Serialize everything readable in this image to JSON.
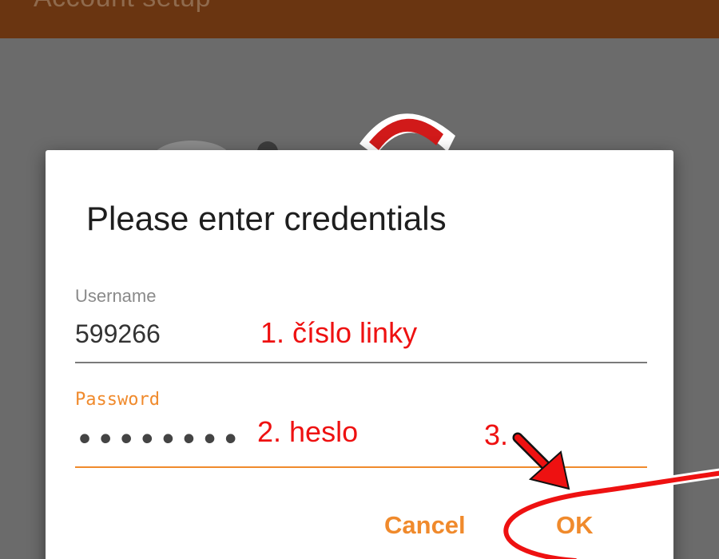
{
  "app_bar": {
    "title": "Account setup"
  },
  "dialog": {
    "title": "Please enter credentials",
    "username": {
      "label": "Username",
      "value": "599266"
    },
    "password": {
      "label": "Password",
      "value": "••••••••"
    },
    "buttons": {
      "cancel": "Cancel",
      "ok": "OK"
    }
  },
  "annotations": {
    "step1": "1. číslo linky",
    "step2": "2. heslo",
    "step3": "3."
  },
  "colors": {
    "app_bar": "#6a3511",
    "accent": "#f08a2c",
    "annotation": "#ee1111",
    "logo_red": "#d11a1a"
  },
  "icons": {
    "background_logo": "phone-logo-icon",
    "annotation_arrow": "arrow-down-right-icon",
    "annotation_circle": "ellipse-highlight-icon"
  }
}
